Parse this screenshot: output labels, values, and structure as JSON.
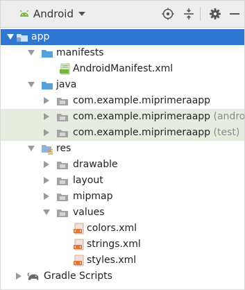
{
  "toolbar": {
    "title": "Android",
    "icons": [
      "android-icon",
      "dropdown-caret-icon",
      "locate-target-icon",
      "collapse-all-icon",
      "gear-icon",
      "hide-panel-icon"
    ]
  },
  "tree": {
    "app": "app",
    "manifests": "manifests",
    "android_manifest": "AndroidManifest.xml",
    "java": "java",
    "pkg_main": "com.example.miprimeraapp",
    "pkg_android_test": "com.example.miprimeraapp",
    "pkg_android_test_suffix": "(androidTe",
    "pkg_test": "com.example.miprimeraapp",
    "pkg_test_suffix": "(test)",
    "res": "res",
    "drawable": "drawable",
    "layout": "layout",
    "mipmap": "mipmap",
    "values": "values",
    "colors": "colors.xml",
    "strings": "strings.xml",
    "styles": "styles.xml",
    "gradle": "Gradle Scripts"
  },
  "colors": {
    "selection": "#2f77d1",
    "highlight": "#e6ede0",
    "android_green": "#77b33d",
    "folder_blue": "#5aa0d8"
  }
}
